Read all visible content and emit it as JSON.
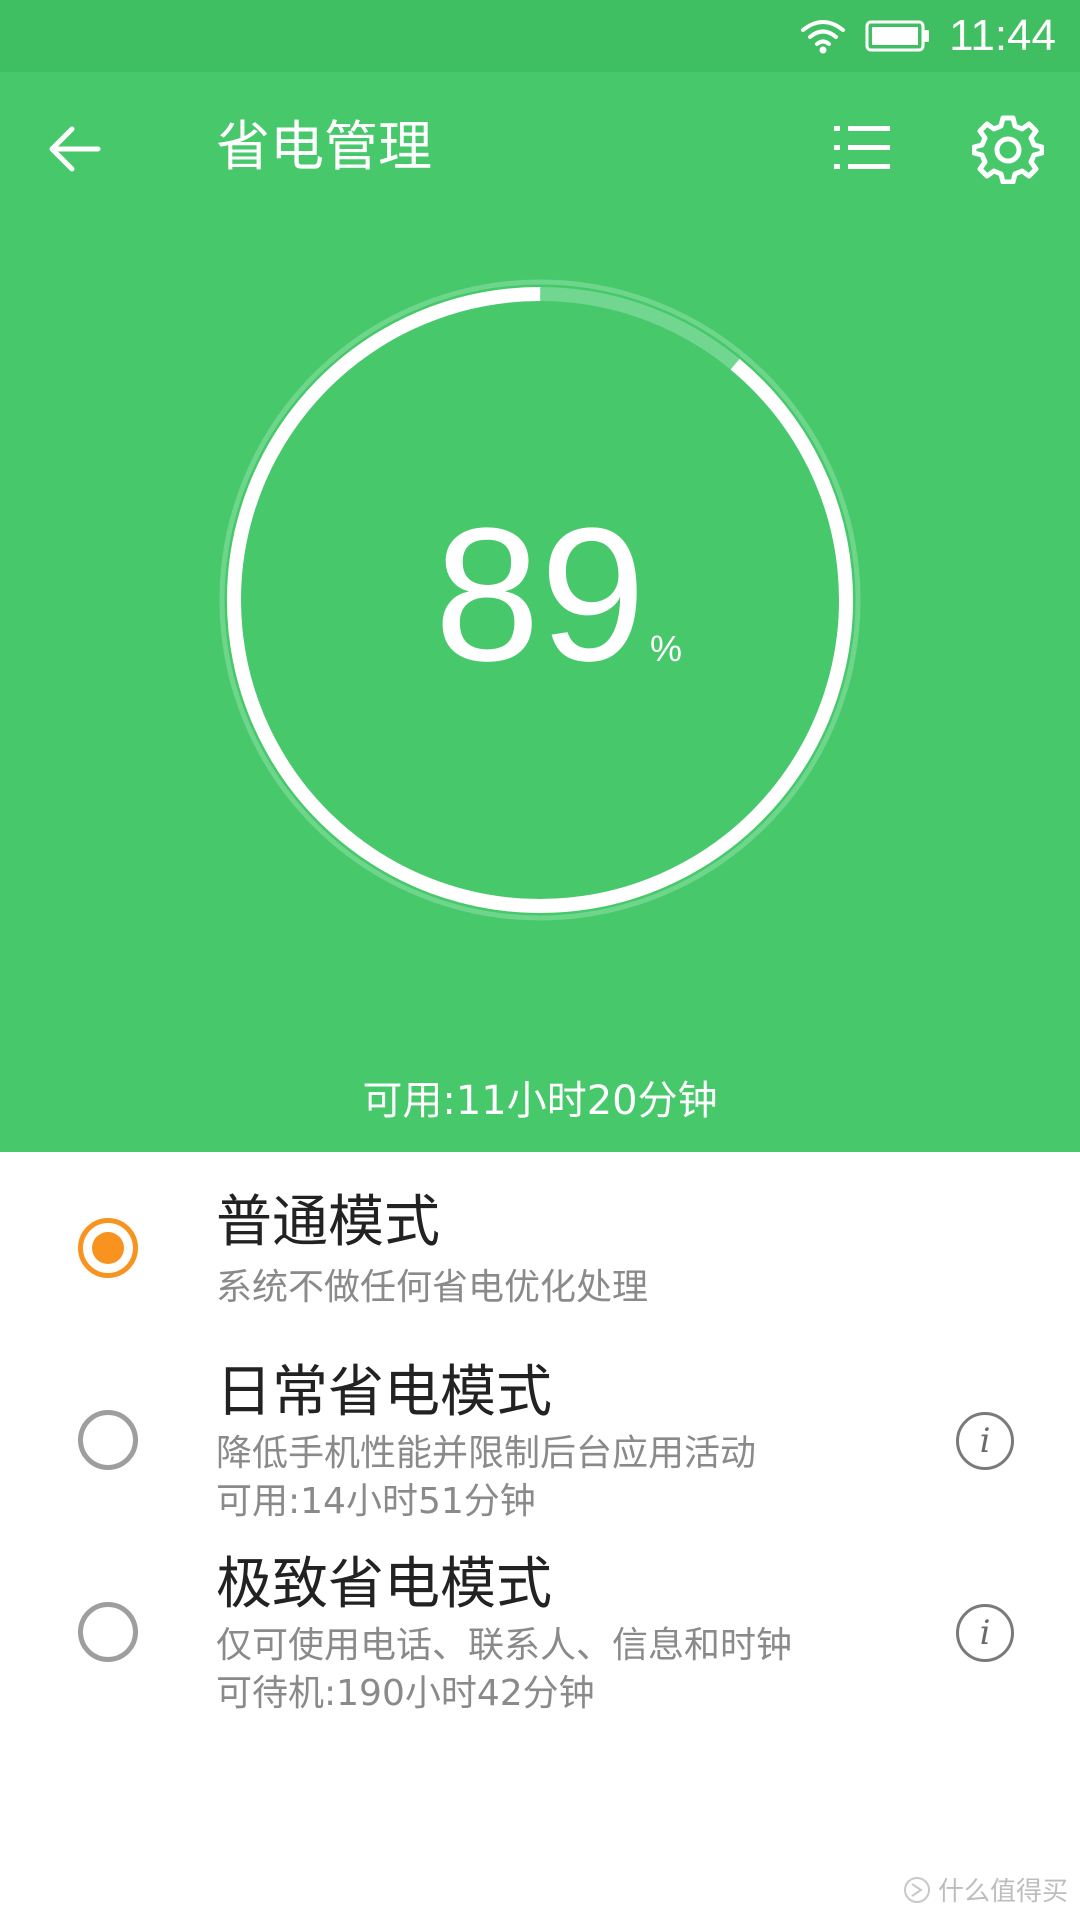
{
  "status_bar": {
    "time": "11:44",
    "icons": [
      "wifi-icon",
      "battery-icon"
    ]
  },
  "toolbar": {
    "title": "省电管理",
    "icons": [
      "back-arrow-icon",
      "list-icon",
      "gear-icon"
    ]
  },
  "battery": {
    "percent": "89",
    "percent_sign": "%",
    "level": 0.89,
    "available_time": "可用:11小时20分钟"
  },
  "modes": [
    {
      "title": "普通模式",
      "desc": "系统不做任何省电优化处理",
      "desc2": "",
      "selected": true,
      "has_info": false
    },
    {
      "title": "日常省电模式",
      "desc": "降低手机性能并限制后台应用活动",
      "desc2": "可用:14小时51分钟",
      "selected": false,
      "has_info": true
    },
    {
      "title": "极致省电模式",
      "desc": "仅可使用电话、联系人、信息和时钟",
      "desc2": "可待机:190小时42分钟",
      "selected": false,
      "has_info": true
    }
  ],
  "info_glyph": "i",
  "watermark": "什么值得买",
  "colors": {
    "header_green": "#46c86b",
    "status_green": "#3fbf61",
    "accent_orange": "#f7931e"
  }
}
